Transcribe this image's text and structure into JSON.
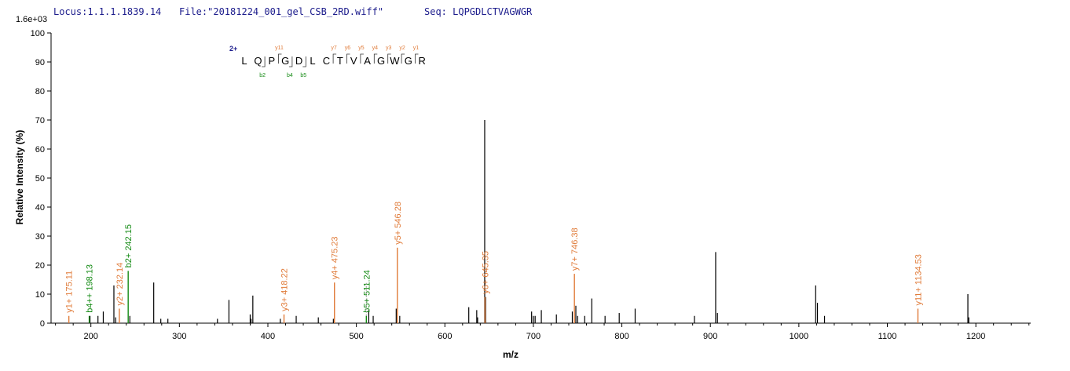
{
  "header": {
    "locus": "Locus:1.1.1.1839.14",
    "file": "File:\"20181224_001_gel_CSB_2RD.wiff\"",
    "seq": "Seq: LQPGDLCTVAGWGR"
  },
  "colors": {
    "header_text": "#1c1c8c",
    "y_ion": "#e07b39",
    "b_ion": "#138a13",
    "unassigned": "#000000",
    "charge_label": "#1c1c8c"
  },
  "chart_data": {
    "type": "bar",
    "multiplier_label": "1.6e+03",
    "xlabel": "m/z",
    "ylabel": "Relative   Intensity (%)",
    "xlim": [
      155,
      1262
    ],
    "ylim": [
      0,
      100
    ],
    "xticks": [
      200,
      300,
      400,
      500,
      600,
      700,
      800,
      900,
      1000,
      1100,
      1200
    ],
    "yticks": [
      0,
      10,
      20,
      30,
      40,
      50,
      60,
      70,
      80,
      90,
      100
    ],
    "grid": false,
    "peptide": {
      "charge_label": "2+",
      "residues": [
        "L",
        "Q",
        "P",
        "G",
        "D",
        "L",
        "C",
        "T",
        "V",
        "A",
        "G",
        "W",
        "G",
        "R"
      ],
      "b_marks": [
        {
          "after": 2,
          "label": "b2"
        },
        {
          "after": 4,
          "label": "b4"
        },
        {
          "after": 5,
          "label": "b5"
        }
      ],
      "y_marks": [
        {
          "after": 3,
          "label": "y11"
        },
        {
          "after": 7,
          "label": "y7"
        },
        {
          "after": 8,
          "label": "y6"
        },
        {
          "after": 9,
          "label": "y5"
        },
        {
          "after": 10,
          "label": "y4"
        },
        {
          "after": 11,
          "label": "y3"
        },
        {
          "after": 12,
          "label": "y2"
        },
        {
          "after": 13,
          "label": "y1"
        }
      ]
    },
    "annotated_peaks": [
      {
        "mz": 175.11,
        "intensity": 2.5,
        "ion": "y",
        "label": "y1+ 175.11"
      },
      {
        "mz": 198.13,
        "intensity": 2.5,
        "ion": "b",
        "label": "b4++ 198.13"
      },
      {
        "mz": 232.14,
        "intensity": 5,
        "ion": "y",
        "label": "y2+ 232.14"
      },
      {
        "mz": 242.15,
        "intensity": 18,
        "ion": "b",
        "label": "b2+ 242.15"
      },
      {
        "mz": 418.22,
        "intensity": 3,
        "ion": "y",
        "label": "y3+ 418.22"
      },
      {
        "mz": 475.23,
        "intensity": 14,
        "ion": "y",
        "label": "y4+ 475.23"
      },
      {
        "mz": 511.24,
        "intensity": 2.5,
        "ion": "b",
        "label": "b5+ 511.24"
      },
      {
        "mz": 546.28,
        "intensity": 26,
        "ion": "y",
        "label": "y5+ 546.28"
      },
      {
        "mz": 645.35,
        "intensity": 9,
        "ion": "y",
        "label": "y6+ 645.35"
      },
      {
        "mz": 746.38,
        "intensity": 17,
        "ion": "y",
        "label": "y7+ 746.38"
      },
      {
        "mz": 1134.53,
        "intensity": 5,
        "ion": "y",
        "label": "y11+ 1134.53"
      }
    ],
    "peaks": [
      [
        199,
        2.5
      ],
      [
        208,
        2.5
      ],
      [
        214,
        4
      ],
      [
        226,
        13
      ],
      [
        228,
        2
      ],
      [
        244,
        2.5
      ],
      [
        271,
        14
      ],
      [
        279,
        1.5
      ],
      [
        287,
        1.5
      ],
      [
        343,
        1.5
      ],
      [
        356,
        8
      ],
      [
        380,
        3
      ],
      [
        381,
        1.5
      ],
      [
        383,
        9.5
      ],
      [
        414,
        1.5
      ],
      [
        432,
        2.5
      ],
      [
        457,
        2
      ],
      [
        474,
        1.5
      ],
      [
        514,
        4.5
      ],
      [
        519,
        2.5
      ],
      [
        545,
        5
      ],
      [
        549,
        2.5
      ],
      [
        627,
        5.5
      ],
      [
        636,
        4.5
      ],
      [
        637,
        2
      ],
      [
        645,
        70
      ],
      [
        646,
        9
      ],
      [
        698,
        4
      ],
      [
        700,
        2.5
      ],
      [
        702,
        2.5
      ],
      [
        709,
        4.5
      ],
      [
        726,
        3
      ],
      [
        744,
        4
      ],
      [
        748,
        6
      ],
      [
        750,
        2.5
      ],
      [
        758,
        2.5
      ],
      [
        766,
        8.5
      ],
      [
        781,
        2.5
      ],
      [
        797,
        3.5
      ],
      [
        815,
        5
      ],
      [
        882,
        2.5
      ],
      [
        906,
        24.5
      ],
      [
        908,
        3.5
      ],
      [
        1019,
        13
      ],
      [
        1021,
        7
      ],
      [
        1029,
        2.5
      ],
      [
        1191,
        10
      ],
      [
        1192,
        2
      ]
    ]
  }
}
